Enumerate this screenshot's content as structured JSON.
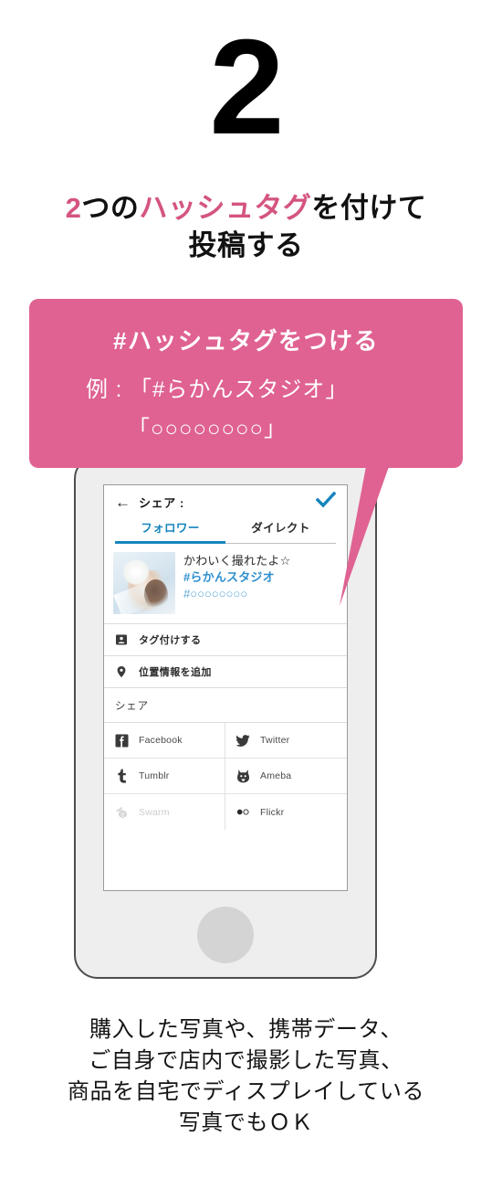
{
  "step": {
    "number": "2",
    "headline_parts": [
      {
        "text": "2",
        "color": "pink"
      },
      {
        "text": "つの",
        "color": "black"
      },
      {
        "text": "ハッシュタグ",
        "color": "pink"
      },
      {
        "text": "を付けて",
        "color": "black"
      }
    ],
    "headline_line1_a": "2",
    "headline_line1_b": "つの",
    "headline_line1_c": "ハッシュタグ",
    "headline_line1_d": "を付けて",
    "headline_line2": "投稿する"
  },
  "callout": {
    "title": "#ハッシュタグをつける",
    "example_line1": "例 : 「#らかんスタジオ」",
    "example_line2": "「○○○○○○○○」"
  },
  "phone": {
    "screen": {
      "nav": {
        "back_icon": "arrow-left-icon",
        "title": "シェア :",
        "confirm_icon": "check-icon"
      },
      "tabs": [
        {
          "label": "フォロワー",
          "active": true
        },
        {
          "label": "ダイレクト",
          "active": false
        }
      ],
      "post": {
        "thumbnail_alt": "post-thumbnail",
        "caption": "かわいく撮れたよ☆",
        "hashtag_primary": "#らかんスタジオ",
        "hashtag_secondary": "#○○○○○○○○"
      },
      "options": [
        {
          "icon": "person-tag-icon",
          "label": "タグ付けする"
        },
        {
          "icon": "location-pin-icon",
          "label": "位置情報を追加"
        }
      ],
      "share_section_title": "シェア",
      "share_targets": [
        {
          "name": "Facebook",
          "icon": "facebook-icon",
          "disabled": false
        },
        {
          "name": "Twitter",
          "icon": "twitter-icon",
          "disabled": false
        },
        {
          "name": "Tumblr",
          "icon": "tumblr-icon",
          "disabled": false
        },
        {
          "name": "Ameba",
          "icon": "ameba-icon",
          "disabled": false
        },
        {
          "name": "Swarm",
          "icon": "swarm-icon",
          "disabled": true
        },
        {
          "name": "Flickr",
          "icon": "flickr-icon",
          "disabled": false
        }
      ]
    }
  },
  "footer": {
    "line1": "購入した写真や、携帯データ、",
    "line2": "ご自身で店内で撮影した写真、",
    "line3": "商品を自宅でディスプレイしている",
    "line4": "写真でもＯＫ"
  },
  "colors": {
    "pink_callout": "#df6292",
    "pink_text": "#d45480",
    "blue_accent": "#1785bd",
    "blue_tag": "#2d8fce",
    "phone_body": "#eeeeee",
    "phone_border": "#4e4e4e",
    "home_button": "#d4d4d4"
  }
}
